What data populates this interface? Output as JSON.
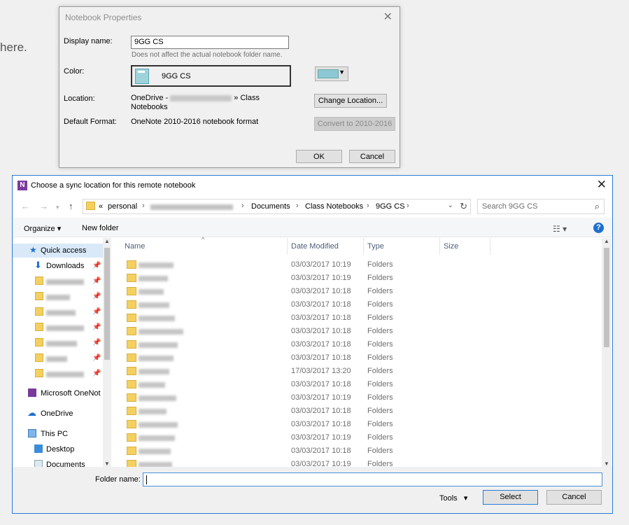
{
  "background": {
    "text": "here."
  },
  "props": {
    "title": "Notebook Properties",
    "display_name_label": "Display name:",
    "display_name_value": "9GG CS",
    "hint": "Does not affect the actual notebook folder name.",
    "color_label": "Color:",
    "color_preview_name": "9GG CS",
    "swatch_color": "#8ec8d4",
    "location_label": "Location:",
    "location_prefix": "OneDrive - ",
    "location_suffix": " » Class",
    "location_line2": "Notebooks",
    "change_location": "Change Location...",
    "format_label": "Default Format:",
    "format_value": "OneNote 2010-2016 notebook format",
    "convert": "Convert to 2010-2016",
    "ok": "OK",
    "cancel": "Cancel"
  },
  "sync": {
    "title": "Choose a sync location for this remote notebook",
    "address": {
      "prefix": "«",
      "crumbs": [
        "personal",
        "Documents",
        "Class Notebooks",
        "9GG CS"
      ]
    },
    "search_placeholder": "Search 9GG CS",
    "toolbar": {
      "organize": "Organize ▾",
      "new_folder": "New folder"
    },
    "nav": {
      "quick_access": "Quick access",
      "downloads": "Downloads",
      "onenote": "Microsoft OneNot",
      "onedrive": "OneDrive",
      "thispc": "This PC",
      "desktop": "Desktop",
      "documents": "Documents"
    },
    "columns": {
      "name": "Name",
      "date": "Date Modified",
      "type": "Type",
      "size": "Size"
    },
    "rows": [
      {
        "date": "03/03/2017 10:19",
        "type": "Folders"
      },
      {
        "date": "03/03/2017 10:19",
        "type": "Folders"
      },
      {
        "date": "03/03/2017 10:18",
        "type": "Folders"
      },
      {
        "date": "03/03/2017 10:18",
        "type": "Folders"
      },
      {
        "date": "03/03/2017 10:18",
        "type": "Folders"
      },
      {
        "date": "03/03/2017 10:18",
        "type": "Folders"
      },
      {
        "date": "03/03/2017 10:18",
        "type": "Folders"
      },
      {
        "date": "03/03/2017 10:18",
        "type": "Folders"
      },
      {
        "date": "17/03/2017 13:20",
        "type": "Folders"
      },
      {
        "date": "03/03/2017 10:18",
        "type": "Folders"
      },
      {
        "date": "03/03/2017 10:19",
        "type": "Folders"
      },
      {
        "date": "03/03/2017 10:18",
        "type": "Folders"
      },
      {
        "date": "03/03/2017 10:18",
        "type": "Folders"
      },
      {
        "date": "03/03/2017 10:19",
        "type": "Folders"
      },
      {
        "date": "03/03/2017 10:18",
        "type": "Folders"
      },
      {
        "date": "03/03/2017 10:19",
        "type": "Folders"
      }
    ],
    "folder_name_label": "Folder name:",
    "folder_name_value": "",
    "tools": "Tools",
    "select": "Select",
    "cancel": "Cancel"
  }
}
